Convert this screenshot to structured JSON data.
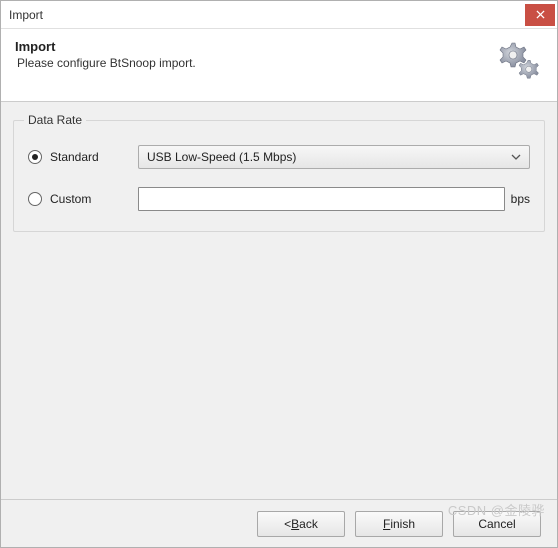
{
  "window": {
    "title": "Import"
  },
  "header": {
    "title": "Import",
    "subtitle": "Please configure BtSnoop import."
  },
  "groupbox": {
    "legend": "Data Rate",
    "standard": {
      "label": "Standard",
      "checked": true,
      "selected_value": "USB Low-Speed (1.5 Mbps)"
    },
    "custom": {
      "label": "Custom",
      "checked": false,
      "value": "",
      "placeholder": "",
      "unit": "bps"
    }
  },
  "footer": {
    "back": {
      "prefix": "< ",
      "mnemonic": "B",
      "rest": "ack"
    },
    "finish": {
      "prefix": "",
      "mnemonic": "F",
      "rest": "inish"
    },
    "cancel": {
      "label": "Cancel"
    }
  },
  "watermark": "CSDN @金陵骅"
}
